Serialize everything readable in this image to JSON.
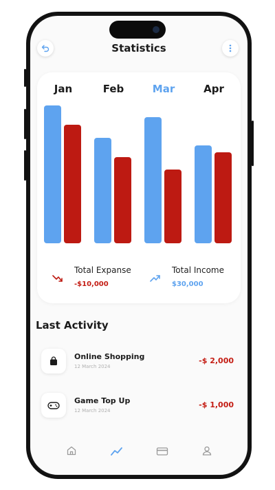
{
  "header": {
    "title": "Statistics"
  },
  "months": [
    {
      "label": "Jan",
      "active": false,
      "expense": 0.86,
      "income": 0.74
    },
    {
      "label": "Feb",
      "active": false,
      "expense": 0.66,
      "income": 0.54
    },
    {
      "label": "Mar",
      "active": true,
      "expense": 0.79,
      "income": 0.46
    },
    {
      "label": "Apr",
      "active": false,
      "expense": 0.61,
      "income": 0.57
    }
  ],
  "chart_data": {
    "type": "bar",
    "categories": [
      "Jan",
      "Feb",
      "Mar",
      "Apr"
    ],
    "series": [
      {
        "values": [
          0.86,
          0.66,
          0.79,
          0.61
        ],
        "color": "#5ea3ef"
      },
      {
        "values": [
          0.74,
          0.54,
          0.46,
          0.57
        ],
        "color": "#bd1a12"
      }
    ]
  },
  "legend": {
    "expense": {
      "label": "Total Expanse",
      "value": "-$10,000",
      "icon": "trend-down-icon"
    },
    "income": {
      "label": "Total Income",
      "value": "$30,000",
      "icon": "trend-up-icon"
    }
  },
  "activity": {
    "title": "Last Activity",
    "items": [
      {
        "name": "Online Shopping",
        "date": "12 March 2024",
        "amount": "-$ 2,000",
        "icon": "shopping-bag-icon"
      },
      {
        "name": "Game Top Up",
        "date": "12 March 2024",
        "amount": "-$ 1,000",
        "icon": "gamepad-icon"
      }
    ]
  },
  "tabs": [
    {
      "name": "home",
      "icon": "home-icon",
      "active": false
    },
    {
      "name": "stats",
      "icon": "chart-icon",
      "active": true
    },
    {
      "name": "cards",
      "icon": "card-icon",
      "active": false
    },
    {
      "name": "profile",
      "icon": "profile-icon",
      "active": false
    }
  ],
  "colors": {
    "accent": "#5ea3ef",
    "expense": "#bd1a12",
    "expense_text": "#c41d14",
    "text": "#1b1b1b",
    "inactive_icon": "#9a9a9a"
  }
}
